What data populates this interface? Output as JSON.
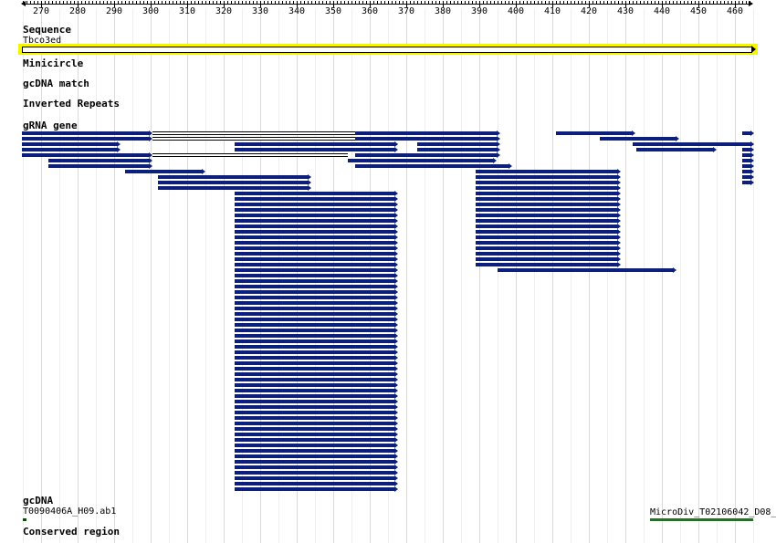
{
  "ruler": {
    "ticks": [
      "270",
      "280",
      "290",
      "300",
      "310",
      "320",
      "330",
      "340",
      "350",
      "360",
      "370",
      "380",
      "390",
      "400",
      "410",
      "420",
      "430",
      "440",
      "450",
      "460"
    ]
  },
  "tracks": {
    "sequence": {
      "title": "Sequence",
      "feature_label": "Tbco3ed"
    },
    "minicircle": {
      "title": "Minicircle"
    },
    "gcdna_match": {
      "title": "gcDNA match"
    },
    "inverted_repeats": {
      "title": "Inverted Repeats"
    },
    "grna_gene": {
      "title": "gRNA gene"
    },
    "gcdna": {
      "title": "gcDNA",
      "left_label": "T0090406A_H09.ab1",
      "right_label": "MicroDiv_T02106042_D08_"
    },
    "conserved_region": {
      "title": "Conserved region"
    }
  },
  "colors": {
    "sequence_highlight": "#f5f500",
    "grna_bar": "#0d1f7d",
    "conserved_bar": "#2e6b2e",
    "grid": "#e2f2f2"
  }
}
